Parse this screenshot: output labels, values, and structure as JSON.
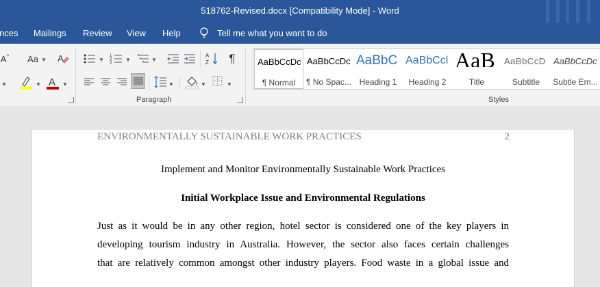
{
  "window": {
    "title": "518762-Revised.docx [Compatibility Mode]  -  Word"
  },
  "menu": {
    "references_partial": "nces",
    "mailings": "Mailings",
    "review": "Review",
    "view": "View",
    "help": "Help",
    "tell_me": "Tell me what you want to do"
  },
  "ribbon": {
    "font": {
      "change_case_label": "Aa",
      "partial_font_label": "A"
    },
    "paragraph": {
      "group_label": "Paragraph",
      "show_marks_glyph": "¶"
    },
    "styles": {
      "group_label": "Styles",
      "items": [
        {
          "preview": "AaBbCcDc",
          "name": "¶ Normal",
          "selected": true
        },
        {
          "preview": "AaBbCcDc",
          "name": "¶ No Spac..."
        },
        {
          "preview": "AaBbC",
          "name": "Heading 1"
        },
        {
          "preview": "AaBbCcl",
          "name": "Heading 2"
        },
        {
          "preview": "AaB",
          "name": "Title"
        },
        {
          "preview": "AaBbCcD",
          "name": "Subtitle"
        },
        {
          "preview": "AaBbCcDc",
          "name": "Subtle Em..."
        }
      ]
    }
  },
  "document": {
    "header_text": "ENVIRONMENTALLY SUSTAINABLE WORK PRACTICES",
    "page_number": "2",
    "title": "Implement and Monitor Environmentally Sustainable Work Practices",
    "heading": "Initial Workplace Issue and Environmental Regulations",
    "body_lines": [
      "Just as it would be in any other region, hotel sector is considered one of the key players in",
      "developing tourism industry in Australia. However, the sector also faces certain challenges",
      "that are relatively common amongst other industry players. Food waste in a global issue and"
    ]
  },
  "colors": {
    "title_bar": "#2b579a",
    "ribbon_bg": "#f3f3f3",
    "canvas_bg": "#e6e6e6",
    "font_color_red": "#c00000",
    "highlight_yellow": "#ffff00",
    "heading_blue": "#2e74b5"
  }
}
